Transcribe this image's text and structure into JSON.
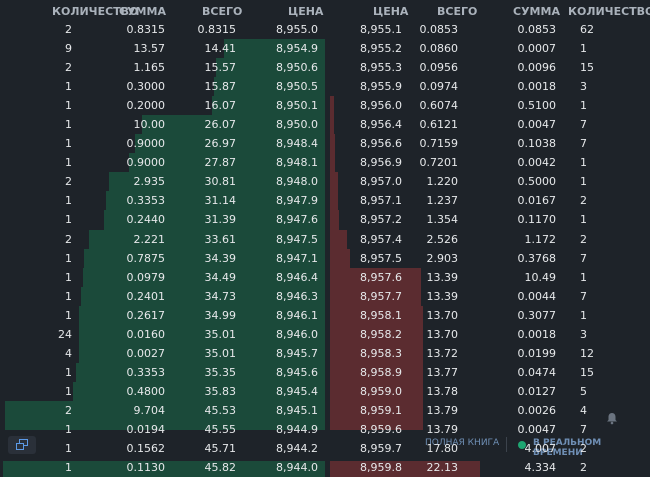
{
  "header": {
    "left": {
      "qty": "КОЛИЧЕСТВО",
      "sum": "СУММА",
      "total": "ВСЕГО",
      "price": "ЦЕНА"
    },
    "right": {
      "price": "ЦЕНА",
      "total": "ВСЕГО",
      "sum": "СУММА",
      "qty": "КОЛИЧЕСТВО"
    }
  },
  "bids": [
    {
      "qty": "2",
      "sum": "0.8315",
      "total": "0.8315",
      "price": "8,955.0",
      "depth": 0
    },
    {
      "qty": "9",
      "sum": "13.57",
      "total": "14.41",
      "price": "8,954.9",
      "depth": 0.314
    },
    {
      "qty": "2",
      "sum": "1.165",
      "total": "15.57",
      "price": "8,950.6",
      "depth": 0.34
    },
    {
      "qty": "1",
      "sum": "0.3000",
      "total": "15.87",
      "price": "8,950.5",
      "depth": 0.346
    },
    {
      "qty": "1",
      "sum": "0.2000",
      "total": "16.07",
      "price": "8,950.1",
      "depth": 0.351
    },
    {
      "qty": "1",
      "sum": "10.00",
      "total": "26.07",
      "price": "8,950.0",
      "depth": 0.569
    },
    {
      "qty": "1",
      "sum": "0.9000",
      "total": "26.97",
      "price": "8,948.4",
      "depth": 0.589
    },
    {
      "qty": "1",
      "sum": "0.9000",
      "total": "27.87",
      "price": "8,948.1",
      "depth": 0.608
    },
    {
      "qty": "2",
      "sum": "2.935",
      "total": "30.81",
      "price": "8,948.0",
      "depth": 0.672
    },
    {
      "qty": "1",
      "sum": "0.3353",
      "total": "31.14",
      "price": "8,947.9",
      "depth": 0.68
    },
    {
      "qty": "1",
      "sum": "0.2440",
      "total": "31.39",
      "price": "8,947.6",
      "depth": 0.685
    },
    {
      "qty": "2",
      "sum": "2.221",
      "total": "33.61",
      "price": "8,947.5",
      "depth": 0.733
    },
    {
      "qty": "1",
      "sum": "0.7875",
      "total": "34.39",
      "price": "8,947.1",
      "depth": 0.75
    },
    {
      "qty": "1",
      "sum": "0.0979",
      "total": "34.49",
      "price": "8,946.4",
      "depth": 0.753
    },
    {
      "qty": "1",
      "sum": "0.2401",
      "total": "34.73",
      "price": "8,946.3",
      "depth": 0.758
    },
    {
      "qty": "1",
      "sum": "0.2617",
      "total": "34.99",
      "price": "8,946.1",
      "depth": 0.764
    },
    {
      "qty": "24",
      "sum": "0.0160",
      "total": "35.01",
      "price": "8,946.0",
      "depth": 0.764
    },
    {
      "qty": "4",
      "sum": "0.0027",
      "total": "35.01",
      "price": "8,945.7",
      "depth": 0.764
    },
    {
      "qty": "1",
      "sum": "0.3353",
      "total": "35.35",
      "price": "8,945.6",
      "depth": 0.772
    },
    {
      "qty": "1",
      "sum": "0.4800",
      "total": "35.83",
      "price": "8,945.4",
      "depth": 0.782
    },
    {
      "qty": "2",
      "sum": "9.704",
      "total": "45.53",
      "price": "8,945.1",
      "depth": 0.994
    },
    {
      "qty": "1",
      "sum": "0.0194",
      "total": "45.55",
      "price": "8,944.9",
      "depth": 0.994
    },
    {
      "qty": "1",
      "sum": "0.1562",
      "total": "45.71",
      "price": "8,944.2",
      "depth": 0.998
    },
    {
      "qty": "1",
      "sum": "0.1130",
      "total": "45.82",
      "price": "8,944.0",
      "depth": 1.0
    }
  ],
  "asks": [
    {
      "price": "8,955.1",
      "total": "0.0853",
      "sum": "0.0853",
      "qty": "62",
      "depth": 0
    },
    {
      "price": "8,955.2",
      "total": "0.0860",
      "sum": "0.0007",
      "qty": "1",
      "depth": 0
    },
    {
      "price": "8,955.3",
      "total": "0.0956",
      "sum": "0.0096",
      "qty": "15",
      "depth": 0
    },
    {
      "price": "8,955.9",
      "total": "0.0974",
      "sum": "0.0018",
      "qty": "3",
      "depth": 0
    },
    {
      "price": "8,956.0",
      "total": "0.6074",
      "sum": "0.5100",
      "qty": "1",
      "depth": 0.027
    },
    {
      "price": "8,956.4",
      "total": "0.6121",
      "sum": "0.0047",
      "qty": "7",
      "depth": 0.028
    },
    {
      "price": "8,956.6",
      "total": "0.7159",
      "sum": "0.1038",
      "qty": "7",
      "depth": 0.032
    },
    {
      "price": "8,956.9",
      "total": "0.7201",
      "sum": "0.0042",
      "qty": "1",
      "depth": 0.033
    },
    {
      "price": "8,957.0",
      "total": "1.220",
      "sum": "0.5000",
      "qty": "1",
      "depth": 0.055
    },
    {
      "price": "8,957.1",
      "total": "1.237",
      "sum": "0.0167",
      "qty": "2",
      "depth": 0.056
    },
    {
      "price": "8,957.2",
      "total": "1.354",
      "sum": "0.1170",
      "qty": "1",
      "depth": 0.061
    },
    {
      "price": "8,957.4",
      "total": "2.526",
      "sum": "1.172",
      "qty": "2",
      "depth": 0.114
    },
    {
      "price": "8,957.5",
      "total": "2.903",
      "sum": "0.3768",
      "qty": "7",
      "depth": 0.131
    },
    {
      "price": "8,957.6",
      "total": "13.39",
      "sum": "10.49",
      "qty": "1",
      "depth": 0.605
    },
    {
      "price": "8,957.7",
      "total": "13.39",
      "sum": "0.0044",
      "qty": "7",
      "depth": 0.605
    },
    {
      "price": "8,958.1",
      "total": "13.70",
      "sum": "0.3077",
      "qty": "1",
      "depth": 0.619
    },
    {
      "price": "8,958.2",
      "total": "13.70",
      "sum": "0.0018",
      "qty": "3",
      "depth": 0.619
    },
    {
      "price": "8,958.3",
      "total": "13.72",
      "sum": "0.0199",
      "qty": "12",
      "depth": 0.62
    },
    {
      "price": "8,958.9",
      "total": "13.77",
      "sum": "0.0474",
      "qty": "15",
      "depth": 0.622
    },
    {
      "price": "8,959.0",
      "total": "13.78",
      "sum": "0.0127",
      "qty": "5",
      "depth": 0.623
    },
    {
      "price": "8,959.1",
      "total": "13.79",
      "sum": "0.0026",
      "qty": "4",
      "depth": 0.623
    },
    {
      "price": "8,959.6",
      "total": "13.79",
      "sum": "0.0047",
      "qty": "7",
      "depth": 0.623
    },
    {
      "price": "8,959.7",
      "total": "17.80",
      "sum": "4.007",
      "qty": "2",
      "depth": 0.804
    },
    {
      "price": "8,959.8",
      "total": "22.13",
      "sum": "4.334",
      "qty": "2",
      "depth": 1.0
    }
  ],
  "colors": {
    "bid_bar": "#1b4a3a",
    "ask_bar": "#5b2c30",
    "live_dot": "#1ea672",
    "background": "#1e2329"
  },
  "icons": {
    "layout": "window-restore-icon",
    "notify": "bell-icon"
  },
  "footer": {
    "full_book": "ПОЛНАЯ КНИГА",
    "realtime": "В РЕАЛЬНОМ ВРЕМЕНИ"
  }
}
